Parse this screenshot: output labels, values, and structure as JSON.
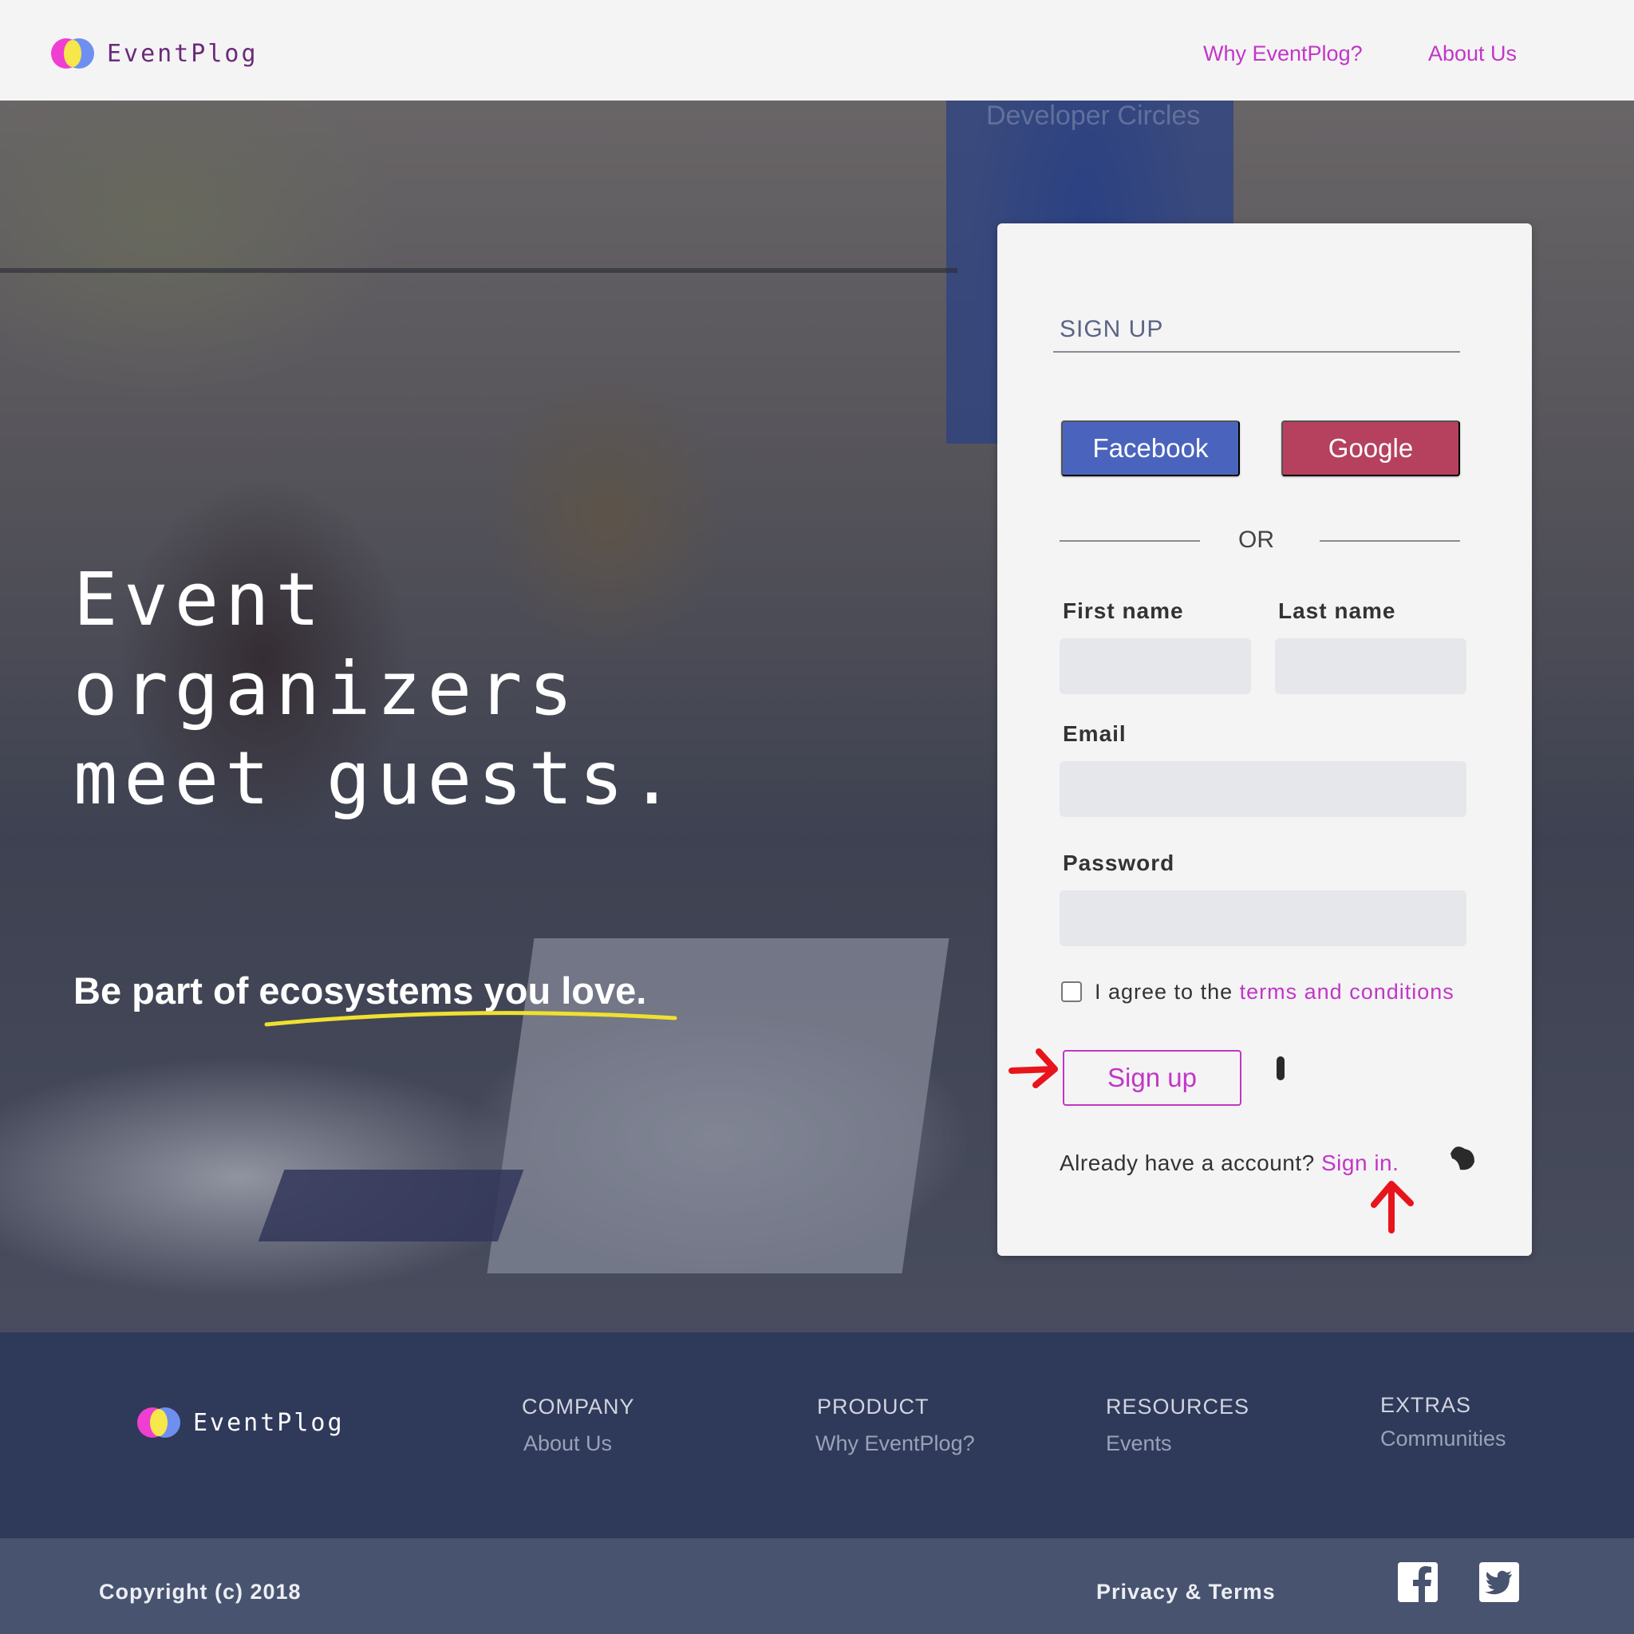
{
  "header": {
    "brand": "EventPlog",
    "nav": [
      "Why EventPlog?",
      "About Us"
    ]
  },
  "hero": {
    "banner_text": "Developer Circles",
    "headline": [
      "Event",
      "organizers",
      "meet guests."
    ],
    "tagline": "Be part of ecosystems you love."
  },
  "signup": {
    "title": "SIGN UP",
    "facebook_label": "Facebook",
    "google_label": "Google",
    "or_label": "OR",
    "first_name_label": "First name",
    "last_name_label": "Last name",
    "email_label": "Email",
    "password_label": "Password",
    "first_name_value": "",
    "last_name_value": "",
    "email_value": "",
    "password_value": "",
    "agree_prefix": "I agree to the",
    "agree_link": "terms and conditions",
    "agree_checked": false,
    "signup_button": "Sign up",
    "already_text": "Already have a account?",
    "signin_link": "Sign in."
  },
  "footer": {
    "brand": "EventPlog",
    "columns": [
      {
        "heading": "COMPANY",
        "links": [
          "About Us"
        ]
      },
      {
        "heading": "PRODUCT",
        "links": [
          "Why EventPlog?"
        ]
      },
      {
        "heading": "RESOURCES",
        "links": [
          "Events"
        ]
      },
      {
        "heading": "EXTRAS",
        "links": [
          "Communities"
        ]
      }
    ],
    "copyright": "Copyright (c) 2018",
    "privacy": "Privacy & Terms",
    "social_icons": [
      "facebook-icon",
      "twitter-icon"
    ]
  },
  "colors": {
    "accent": "#c236c8",
    "facebook": "#4a64be",
    "google": "#b5415e",
    "footer_bg": "#2f3a5a",
    "bottom_bar_bg": "#48536f",
    "annotation": "#e8141c"
  }
}
